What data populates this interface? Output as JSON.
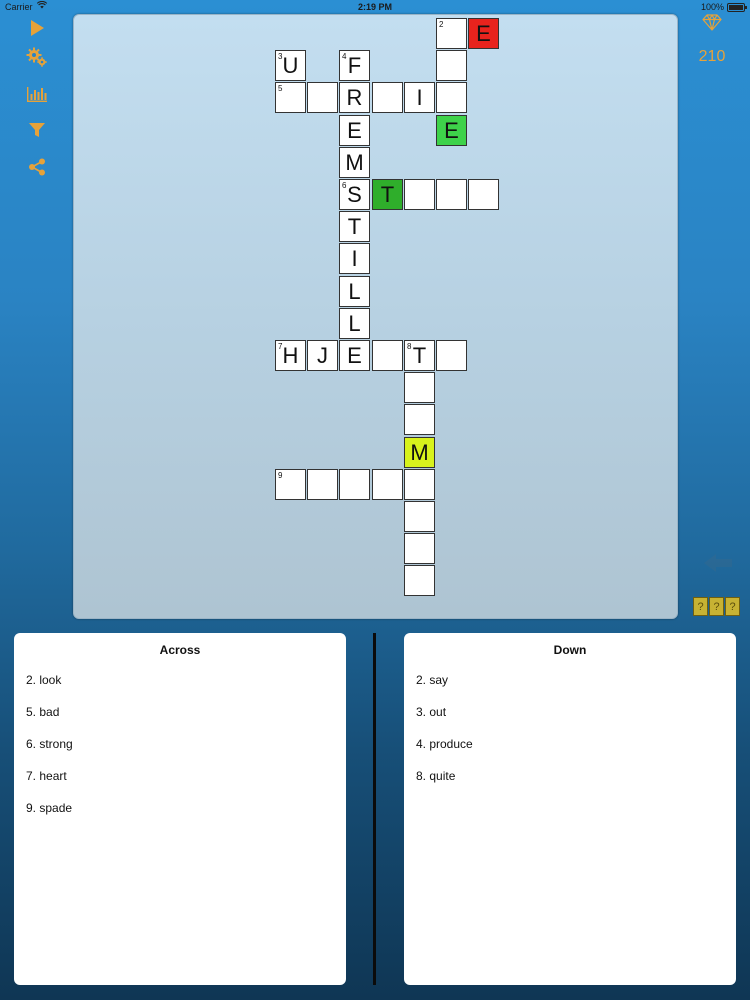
{
  "status_bar": {
    "carrier": "Carrier",
    "time": "2:19 PM",
    "battery": "100%"
  },
  "toolbar": {
    "accent_color": "#e5a23a",
    "items": [
      {
        "name": "play-icon"
      },
      {
        "name": "settings-gears-icon"
      },
      {
        "name": "stats-icon"
      },
      {
        "name": "filter-icon"
      },
      {
        "name": "share-icon"
      }
    ]
  },
  "score": {
    "icon": "diamond-icon",
    "value": "210"
  },
  "board": {
    "cells": [
      {
        "r": 0,
        "c": 5,
        "num": "2",
        "letter": "",
        "color": "#ffffff"
      },
      {
        "r": 0,
        "c": 6,
        "num": "",
        "letter": "E",
        "color": "#e8231d"
      },
      {
        "r": 1,
        "c": 0,
        "num": "3",
        "letter": "U",
        "color": "#ffffff"
      },
      {
        "r": 1,
        "c": 2,
        "num": "4",
        "letter": "F",
        "color": "#ffffff"
      },
      {
        "r": 1,
        "c": 5,
        "num": "",
        "letter": "",
        "color": "#ffffff"
      },
      {
        "r": 2,
        "c": 0,
        "num": "5",
        "letter": "",
        "color": "#ffffff"
      },
      {
        "r": 2,
        "c": 1,
        "num": "",
        "letter": "",
        "color": "#ffffff"
      },
      {
        "r": 2,
        "c": 2,
        "num": "",
        "letter": "R",
        "color": "#ffffff"
      },
      {
        "r": 2,
        "c": 3,
        "num": "",
        "letter": "",
        "color": "#ffffff"
      },
      {
        "r": 2,
        "c": 4,
        "num": "",
        "letter": "I",
        "color": "#ffffff"
      },
      {
        "r": 2,
        "c": 5,
        "num": "",
        "letter": "",
        "color": "#ffffff"
      },
      {
        "r": 3,
        "c": 2,
        "num": "",
        "letter": "E",
        "color": "#ffffff"
      },
      {
        "r": 3,
        "c": 5,
        "num": "",
        "letter": "E",
        "color": "#3ed24a"
      },
      {
        "r": 4,
        "c": 2,
        "num": "",
        "letter": "M",
        "color": "#ffffff"
      },
      {
        "r": 5,
        "c": 2,
        "num": "6",
        "letter": "S",
        "color": "#ffffff"
      },
      {
        "r": 5,
        "c": 3,
        "num": "",
        "letter": "T",
        "color": "#2fae2b"
      },
      {
        "r": 5,
        "c": 4,
        "num": "",
        "letter": "",
        "color": "#ffffff"
      },
      {
        "r": 5,
        "c": 5,
        "num": "",
        "letter": "",
        "color": "#ffffff"
      },
      {
        "r": 5,
        "c": 6,
        "num": "",
        "letter": "",
        "color": "#ffffff"
      },
      {
        "r": 6,
        "c": 2,
        "num": "",
        "letter": "T",
        "color": "#ffffff"
      },
      {
        "r": 7,
        "c": 2,
        "num": "",
        "letter": "I",
        "color": "#ffffff"
      },
      {
        "r": 8,
        "c": 2,
        "num": "",
        "letter": "L",
        "color": "#ffffff"
      },
      {
        "r": 9,
        "c": 2,
        "num": "",
        "letter": "L",
        "color": "#ffffff"
      },
      {
        "r": 10,
        "c": 0,
        "num": "7",
        "letter": "H",
        "color": "#ffffff"
      },
      {
        "r": 10,
        "c": 1,
        "num": "",
        "letter": "J",
        "color": "#ffffff"
      },
      {
        "r": 10,
        "c": 2,
        "num": "",
        "letter": "E",
        "color": "#ffffff"
      },
      {
        "r": 10,
        "c": 3,
        "num": "",
        "letter": "",
        "color": "#ffffff"
      },
      {
        "r": 10,
        "c": 4,
        "num": "8",
        "letter": "T",
        "color": "#ffffff"
      },
      {
        "r": 10,
        "c": 5,
        "num": "",
        "letter": "",
        "color": "#ffffff"
      },
      {
        "r": 11,
        "c": 4,
        "num": "",
        "letter": "",
        "color": "#ffffff"
      },
      {
        "r": 12,
        "c": 4,
        "num": "",
        "letter": "",
        "color": "#ffffff"
      },
      {
        "r": 13,
        "c": 4,
        "num": "",
        "letter": "M",
        "color": "#d8f21c"
      },
      {
        "r": 14,
        "c": 0,
        "num": "9",
        "letter": "",
        "color": "#ffffff"
      },
      {
        "r": 14,
        "c": 1,
        "num": "",
        "letter": "",
        "color": "#ffffff"
      },
      {
        "r": 14,
        "c": 2,
        "num": "",
        "letter": "",
        "color": "#ffffff"
      },
      {
        "r": 14,
        "c": 3,
        "num": "",
        "letter": "",
        "color": "#ffffff"
      },
      {
        "r": 14,
        "c": 4,
        "num": "",
        "letter": "",
        "color": "#ffffff"
      },
      {
        "r": 15,
        "c": 4,
        "num": "",
        "letter": "",
        "color": "#ffffff"
      },
      {
        "r": 16,
        "c": 4,
        "num": "",
        "letter": "",
        "color": "#ffffff"
      },
      {
        "r": 17,
        "c": 4,
        "num": "",
        "letter": "",
        "color": "#ffffff"
      }
    ]
  },
  "hint_button": {
    "label": "???"
  },
  "across": {
    "title": "Across",
    "clues": [
      "2. look",
      "5. bad",
      "6. strong",
      "7. heart",
      "9. spade"
    ]
  },
  "down": {
    "title": "Down",
    "clues": [
      "2. say",
      "3. out",
      "4. produce",
      "8. quite"
    ]
  }
}
